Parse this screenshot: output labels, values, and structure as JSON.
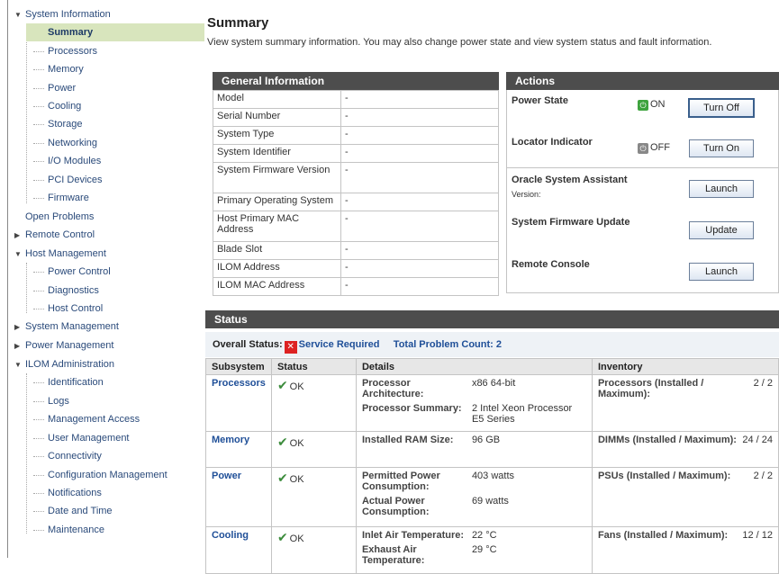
{
  "sidebar": {
    "system_information": "System Information",
    "summary": "Summary",
    "processors": "Processors",
    "memory": "Memory",
    "power": "Power",
    "cooling": "Cooling",
    "storage": "Storage",
    "networking": "Networking",
    "io_modules": "I/O Modules",
    "pci_devices": "PCI Devices",
    "firmware": "Firmware",
    "open_problems": "Open Problems",
    "remote_control": "Remote Control",
    "host_management": "Host Management",
    "power_control": "Power Control",
    "diagnostics": "Diagnostics",
    "host_control": "Host Control",
    "system_management": "System Management",
    "power_management": "Power Management",
    "ilom_administration": "ILOM Administration",
    "identification": "Identification",
    "logs": "Logs",
    "management_access": "Management Access",
    "user_management": "User Management",
    "connectivity": "Connectivity",
    "configuration_management": "Configuration Management",
    "notifications": "Notifications",
    "date_and_time": "Date and Time",
    "maintenance": "Maintenance"
  },
  "page": {
    "title": "Summary",
    "description": "View system summary information. You may also change power state and view system status and fault information."
  },
  "general": {
    "title": "General Information",
    "rows": [
      {
        "key": "Model",
        "value": "-"
      },
      {
        "key": "Serial Number",
        "value": "-"
      },
      {
        "key": "System Type",
        "value": "-"
      },
      {
        "key": "System Identifier",
        "value": "-"
      },
      {
        "key": "System Firmware Version",
        "value": "-"
      },
      {
        "key": "Primary Operating System",
        "value": "-"
      },
      {
        "key": "Host Primary MAC Address",
        "value": "-"
      },
      {
        "key": "Blade Slot",
        "value": "-"
      },
      {
        "key": "ILOM Address",
        "value": "-"
      },
      {
        "key": "ILOM MAC Address",
        "value": "-"
      }
    ]
  },
  "actions": {
    "title": "Actions",
    "power_state_label": "Power State",
    "power_state_value": "ON",
    "turn_off": "Turn Off",
    "locator_label": "Locator Indicator",
    "locator_value": "OFF",
    "turn_on": "Turn On",
    "osa_label": "Oracle System Assistant",
    "osa_version": "Version:",
    "osa_launch": "Launch",
    "fw_update_label": "System Firmware Update",
    "fw_update_button": "Update",
    "remote_console_label": "Remote Console",
    "remote_console_launch": "Launch"
  },
  "status": {
    "title": "Status",
    "overall_label": "Overall Status:",
    "overall_value": "Service Required",
    "problem_count": "Total Problem Count: 2",
    "columns": [
      "Subsystem",
      "Status",
      "Details",
      "Inventory"
    ],
    "rows": [
      {
        "subsystem": "Processors",
        "status": "OK",
        "details": [
          {
            "k": "Processor Architecture:",
            "v": "x86 64-bit"
          },
          {
            "k": "Processor Summary:",
            "v": "2 Intel Xeon Processor E5 Series"
          }
        ],
        "inventory_k": "Processors (Installed / Maximum):",
        "inventory_v": "2 / 2"
      },
      {
        "subsystem": "Memory",
        "status": "OK",
        "details": [
          {
            "k": "Installed RAM Size:",
            "v": "96 GB"
          }
        ],
        "inventory_k": "DIMMs (Installed / Maximum):",
        "inventory_v": "24 / 24"
      },
      {
        "subsystem": "Power",
        "status": "OK",
        "details": [
          {
            "k": "Permitted Power Consumption:",
            "v": "403 watts"
          },
          {
            "k": "Actual Power Consumption:",
            "v": "69 watts"
          }
        ],
        "inventory_k": "PSUs (Installed / Maximum):",
        "inventory_v": "2 / 2"
      },
      {
        "subsystem": "Cooling",
        "status": "OK",
        "details": [
          {
            "k": "Inlet Air Temperature:",
            "v": "22 °C"
          },
          {
            "k": "Exhaust Air Temperature:",
            "v": "29 °C"
          }
        ],
        "inventory_k": "Fans (Installed / Maximum):",
        "inventory_v": "12 / 12"
      }
    ]
  },
  "colors": {
    "nav_selected_bg": "#d8e5bd",
    "panel_header_bg": "#4d4d4d",
    "link_blue": "#1f4f98",
    "ok_green": "#3c8c3c",
    "error_red": "#dd2222"
  }
}
